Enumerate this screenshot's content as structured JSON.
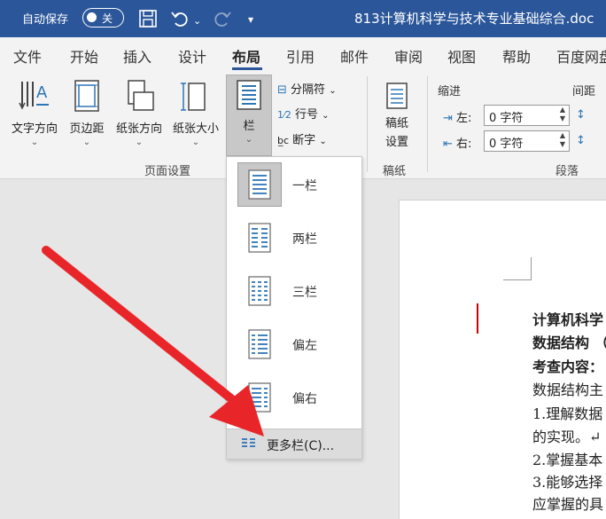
{
  "titlebar": {
    "autosave_label": "自动保存",
    "toggle_state": "关",
    "doc_title": "813计算机科学与技术专业基础综合.doc"
  },
  "tabs": [
    "文件",
    "开始",
    "插入",
    "设计",
    "布局",
    "引用",
    "邮件",
    "审阅",
    "视图",
    "帮助",
    "百度网盘"
  ],
  "active_tab": "布局",
  "ribbon": {
    "text_direction": "文字方向",
    "margins": "页边距",
    "orientation": "纸张方向",
    "size": "纸张大小",
    "columns": "栏",
    "breaks": "分隔符",
    "line_numbers": "行号",
    "hyphenation": "断字",
    "page_setup_group": "页面设置",
    "draft_settings": [
      "稿纸",
      "设置"
    ],
    "draft_group": "稿纸",
    "indent_title": "缩进",
    "indent_left_label": "左:",
    "indent_left_value": "0 字符",
    "indent_right_label": "右:",
    "indent_right_value": "0 字符",
    "spacing_title": "间距",
    "paragraph_group": "段落"
  },
  "columns_menu": {
    "items": [
      "一栏",
      "两栏",
      "三栏",
      "偏左",
      "偏右"
    ],
    "more": "更多栏(C)..."
  },
  "document": {
    "lines": [
      {
        "text": "计算机科学",
        "bold": true
      },
      {
        "text": "数据结构 （",
        "bold": true
      },
      {
        "text": "考查内容：",
        "bold": true
      },
      {
        "text": "数据结构主",
        "bold": false
      },
      {
        "text": "1.理解数据",
        "bold": false
      },
      {
        "text": "的实现。↵",
        "bold": false
      },
      {
        "text": "2.掌握基本",
        "bold": false
      },
      {
        "text": "3.能够选择",
        "bold": false
      },
      {
        "text": "应掌握的具",
        "bold": false
      }
    ]
  },
  "colors": {
    "title_bar": "#2b579a",
    "ribbon_bg": "#f3f3f3",
    "arrow": "#e8262a",
    "icon_blue": "#2e75b6"
  }
}
